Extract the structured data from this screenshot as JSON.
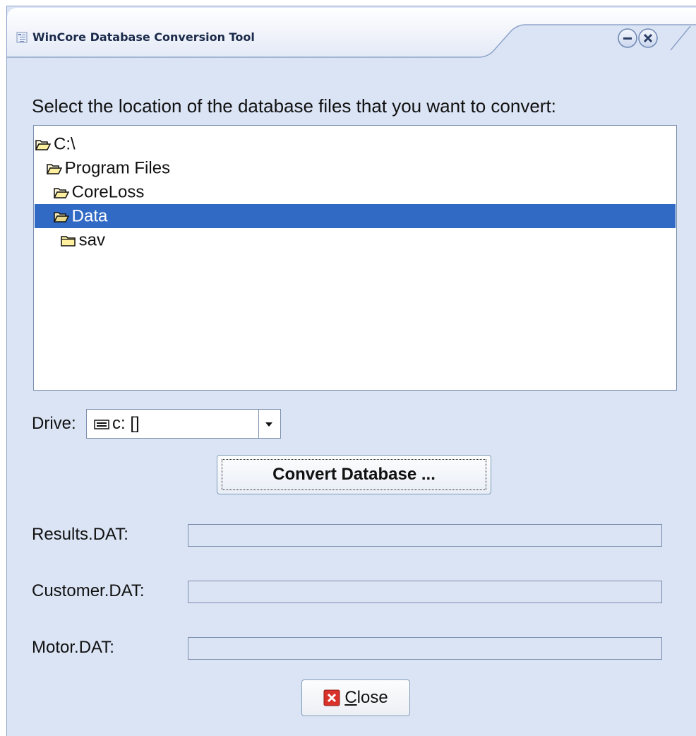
{
  "window": {
    "title": "WinCore Database Conversion Tool"
  },
  "prompt": "Select the location of the database files that you want to convert:",
  "directories": [
    {
      "label": "C:\\",
      "state": "open",
      "level": 0
    },
    {
      "label": "Program Files",
      "state": "open",
      "level": 1
    },
    {
      "label": "CoreLoss",
      "state": "open",
      "level": 2
    },
    {
      "label": "Data",
      "state": "open",
      "level": 3,
      "selected": true
    },
    {
      "label": "sav",
      "state": "closed",
      "level": 4
    }
  ],
  "drive": {
    "label": "Drive:",
    "value": "c: []",
    "icon": "drive-icon"
  },
  "convert_button": "Convert Database ...",
  "progress_rows": [
    {
      "label": "Results.DAT:",
      "progress": 0
    },
    {
      "label": "Customer.DAT:",
      "progress": 0
    },
    {
      "label": "Motor.DAT:",
      "progress": 0
    }
  ],
  "close_button": {
    "mnemonic": "C",
    "rest": "lose",
    "icon": "close-x-icon"
  },
  "colors": {
    "window_bg": "#dbe4f5",
    "selection": "#316ac5",
    "border": "#7b8fae"
  }
}
